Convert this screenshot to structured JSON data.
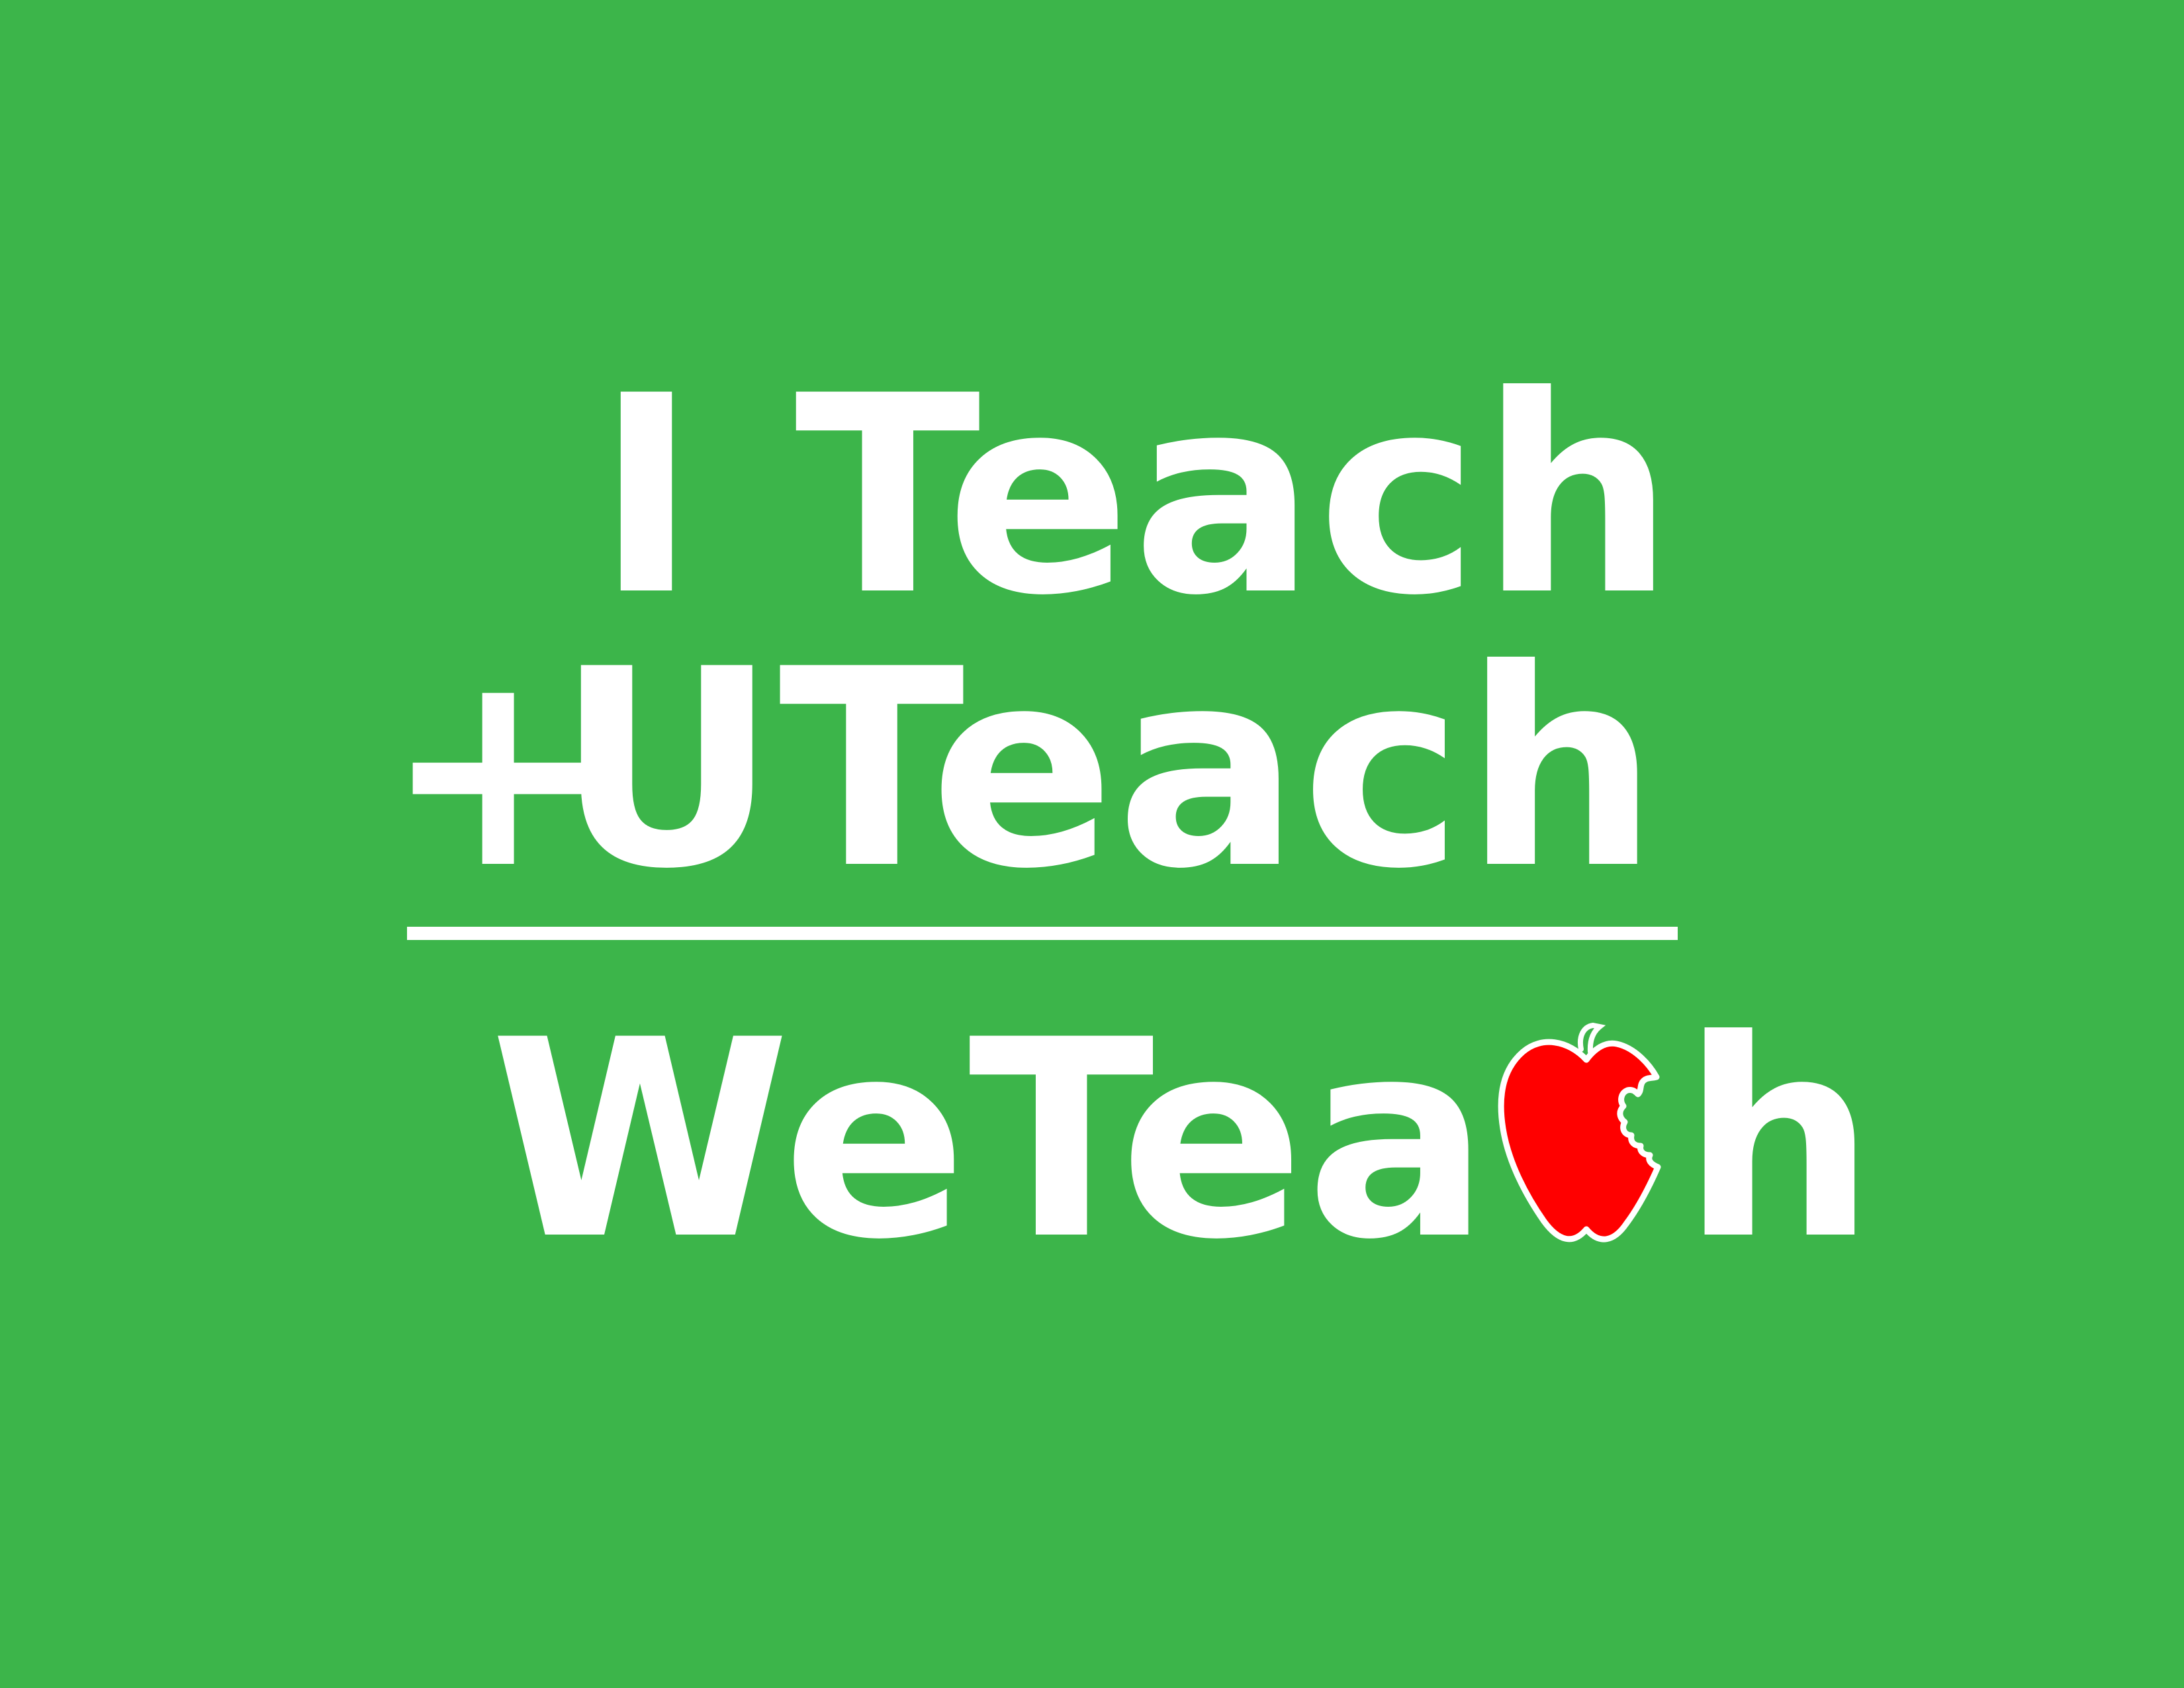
{
  "equation": {
    "line1": "I Teach",
    "plus_sign": "+",
    "line2": "UTeach",
    "result_before_apple": "WeTea",
    "result_apple_letter": "c",
    "result_after_apple": "h"
  },
  "colors": {
    "background": "#3cb54a",
    "text": "#ffffff",
    "apple": "#ff0000"
  },
  "icons": {
    "apple": "bitten-apple-icon"
  }
}
